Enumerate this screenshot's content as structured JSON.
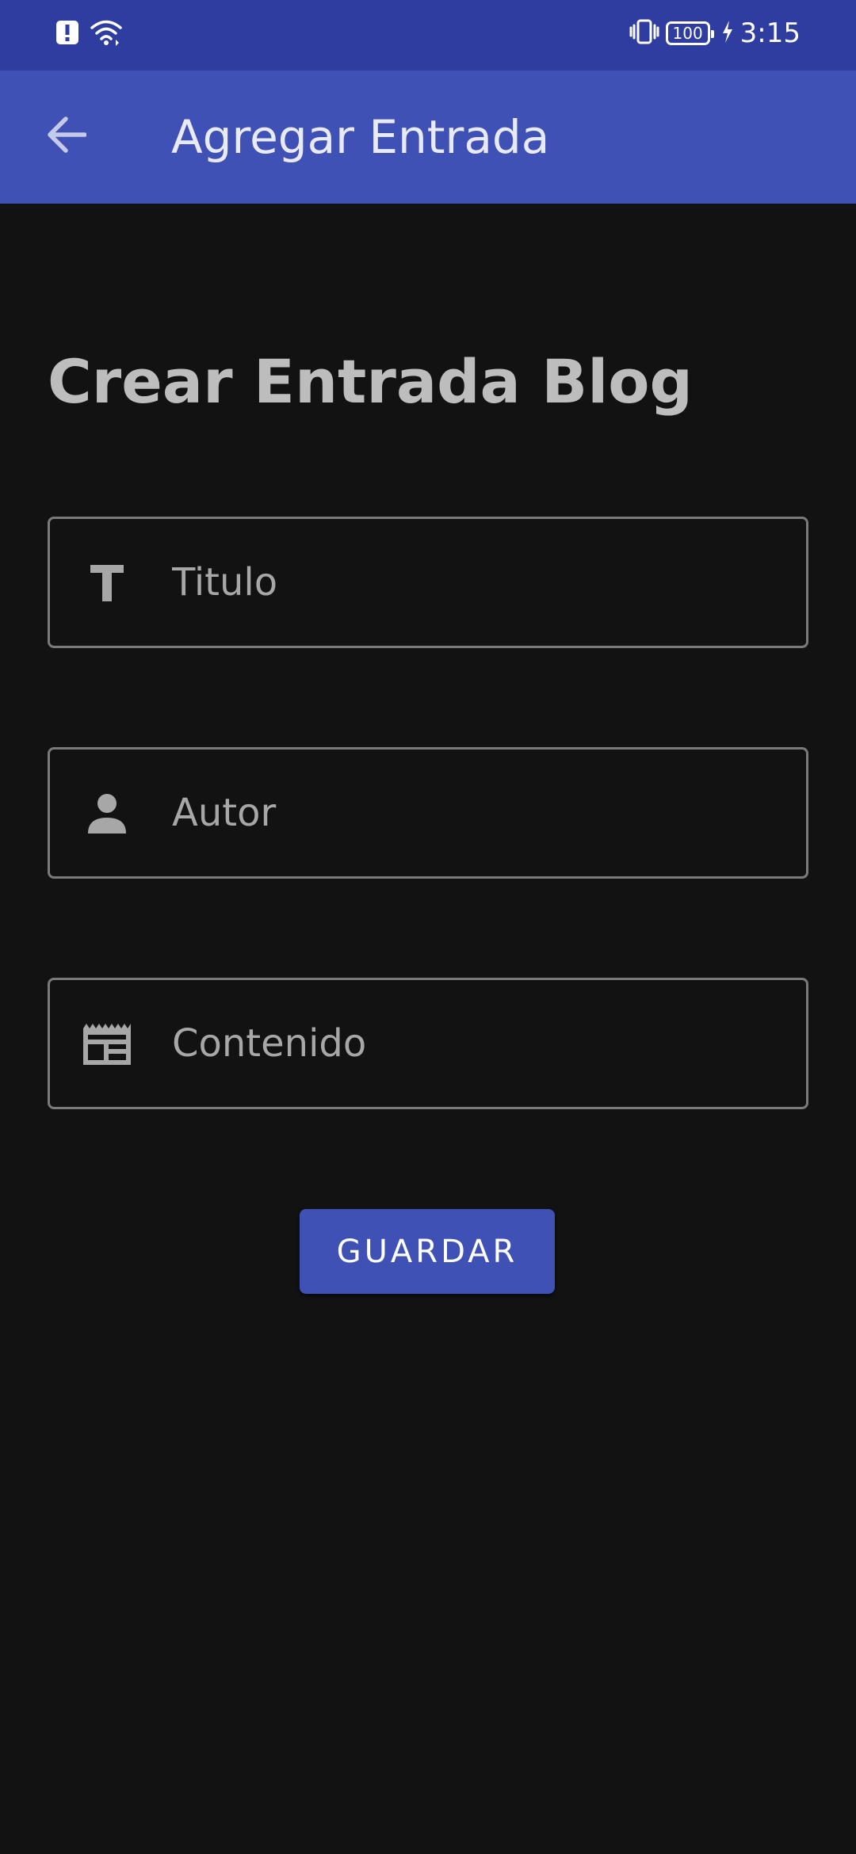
{
  "status_bar": {
    "time": "3:15",
    "battery_level": "100",
    "icons": [
      "alert-icon",
      "wifi-icon",
      "vibrate-icon",
      "battery-icon",
      "charging-icon"
    ]
  },
  "app_bar": {
    "title": "Agregar Entrada",
    "back_icon": "arrow-left-icon"
  },
  "form": {
    "heading": "Crear Entrada Blog",
    "fields": [
      {
        "placeholder": "Titulo",
        "value": "",
        "icon": "text-format-icon"
      },
      {
        "placeholder": "Autor",
        "value": "",
        "icon": "person-icon"
      },
      {
        "placeholder": "Contenido",
        "value": "",
        "icon": "article-icon"
      }
    ],
    "save_label": "GUARDAR"
  },
  "colors": {
    "status_bar": "#2f3ca0",
    "app_bar": "#3f51b5",
    "background": "#121212",
    "button": "#3f51b5",
    "field_border": "#7a7a7a",
    "icon": "#a7a7a7"
  }
}
